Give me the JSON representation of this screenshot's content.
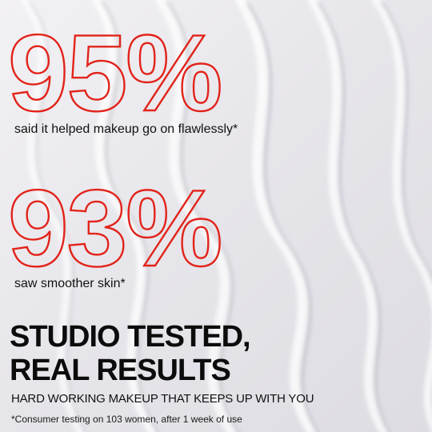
{
  "stats": [
    {
      "value": "95%",
      "caption": "said it helped makeup go on flawlessly*"
    },
    {
      "value": "93%",
      "caption": "saw smoother skin*"
    }
  ],
  "headline": {
    "line1": "STUDIO TESTED,",
    "line2": "REAL RESULTS"
  },
  "subhead": "HARD WORKING MAKEUP THAT KEEPS UP WITH YOU",
  "footnote": "*Consumer testing on 103 women, after 1 week of use",
  "colors": {
    "accent": "#e2231a",
    "text": "#111111",
    "background": "#e9e8ec"
  }
}
